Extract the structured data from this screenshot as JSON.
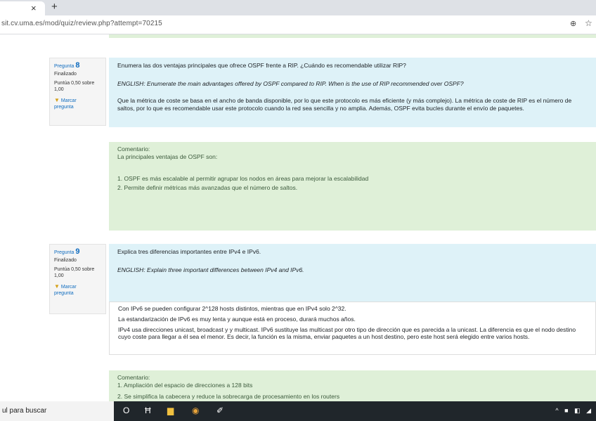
{
  "browser": {
    "tab_close": "×",
    "new_tab": "+",
    "url": "sit.cv.uma.es/mod/quiz/review.php?attempt=70215",
    "zoom_icon": "⊕",
    "star_icon": "☆"
  },
  "questions": [
    {
      "label": "Pregunta",
      "number": "8",
      "state": "Finalizado",
      "grade_line1": "Puntúa 0,50 sobre",
      "grade_line2": "1,00",
      "flag_line1": "Marcar",
      "flag_line2": "pregunta",
      "text": "Enumera las dos ventajas principales que ofrece OSPF frente a RIP. ¿Cuándo es recomendable utilizar RIP?",
      "english": "ENGLISH: Enumerate the main advantages offered by OSPF compared to RIP. When is the use of RIP recommended over OSPF?",
      "answer": "Que la métrica de coste se basa en el ancho de banda disponible, por lo que este protocolo es más eficiente (y más complejo). La métrica de coste de RIP es el número de saltos, por lo que es recomendable usar este protocolo cuando la red sea sencilla y no amplia. Además, OSPF evita bucles durante el envío de paquetes.",
      "feedback_title": "Comentario:",
      "feedback_intro": "La principales ventajas de OSPF son:",
      "feedback_items": [
        "1. OSPF es más escalable al permitir agrupar los nodos en áreas para mejorar la escalabilidad",
        "2. Permite definir métricas más avanzadas que el número de saltos."
      ]
    },
    {
      "label": "Pregunta",
      "number": "9",
      "state": "Finalizado",
      "grade_line1": "Puntúa 0,50 sobre",
      "grade_line2": "1,00",
      "flag_line1": "Marcar",
      "flag_line2": "pregunta",
      "text": "Explica tres diferencias importantes entre IPv4 e IPv6.",
      "english": "ENGLISH: Explain three important differences between IPv4 and IPv6.",
      "answers": [
        "Con IPv6 se pueden configurar 2^128 hosts distintos, mientras que en IPv4 solo 2^32.",
        "La estandarización de IPv6 es muy lenta y aunque está en proceso, durará muchos años.",
        "IPv4 usa direcciones unicast, broadcast y y multicast. IPv6 sustituye las multicast por otro tipo de dirección que es parecida a la unicast. La diferencia es que el nodo destino cuyo coste para llegar a él sea el menor. Es decir, la función es la misma, enviar paquetes a un host destino, pero este host será elegido entre varios hosts."
      ],
      "feedback_title": "Comentario:",
      "feedback_items": [
        "1. Ampliación del espacio de direcciones a 128 bits",
        "2. Se simplifica la cabecera y reduce la sobrecarga de procesamiento en los routers"
      ]
    }
  ],
  "taskbar": {
    "search_text": "ul para buscar",
    "cortana_icon": "O",
    "taskview_icon": "Ħ",
    "explorer_icon": "▆",
    "chrome_icon": "◉",
    "app_icon": "✐",
    "tray_icons": "^ ■ ◧ ◢"
  }
}
